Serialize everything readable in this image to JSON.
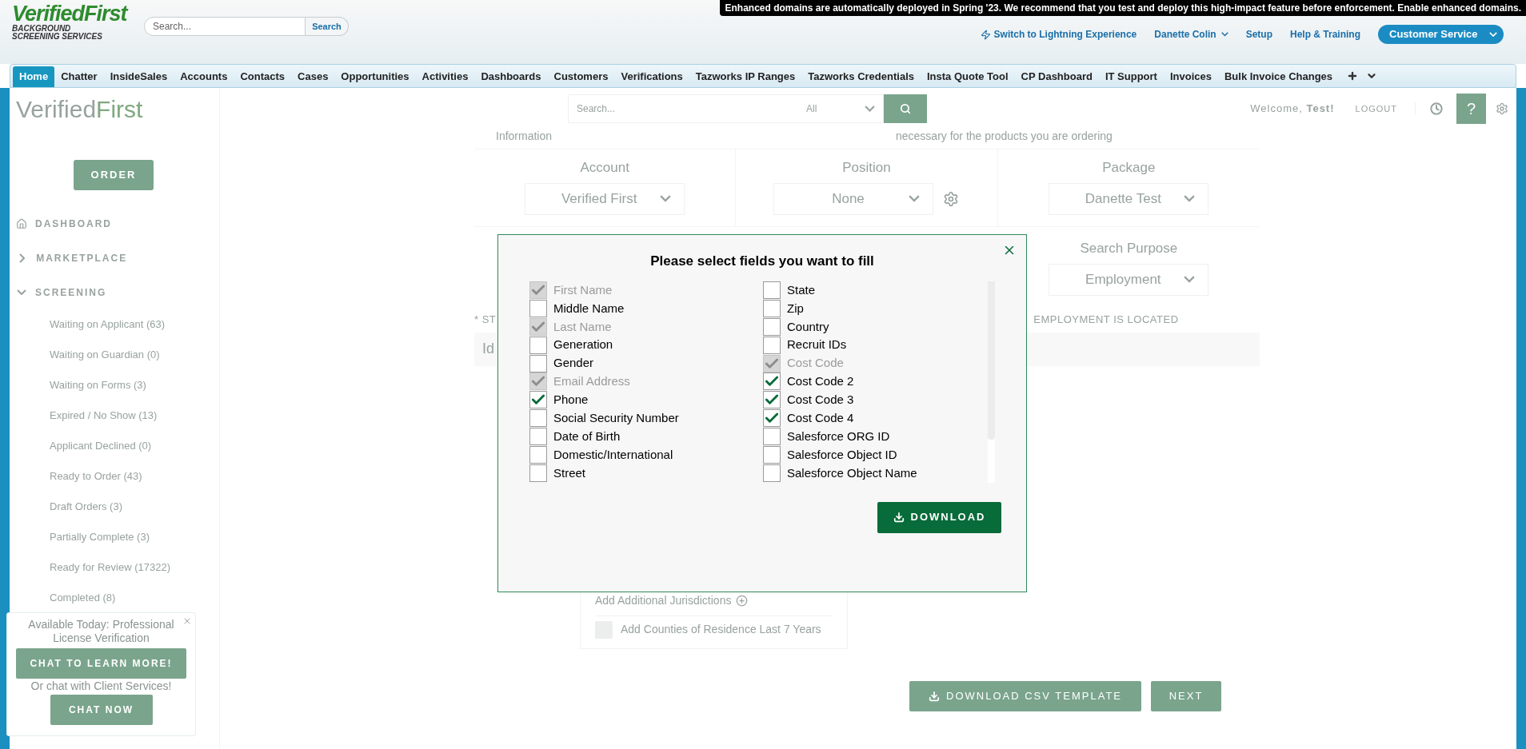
{
  "header": {
    "logo_title": "VerifiedFirst",
    "logo_lines": [
      "BACKGROUND",
      "SCREENING SERVICES"
    ],
    "search_placeholder": "Search...",
    "search_button": "Search",
    "notice": "Enhanced domains are automatically deployed in Spring '23. We recommend that you test and deploy this high-impact feature before enforcement. Enable enhanced domains.",
    "lightning_link": "Switch to Lightning Experience",
    "user_menu": "Danette Colin",
    "links": [
      "Setup",
      "Help & Training"
    ],
    "app_menu": "Customer Service"
  },
  "tabs": [
    {
      "label": "Home",
      "selected": true
    },
    {
      "label": "Chatter",
      "selected": false
    },
    {
      "label": "InsideSales",
      "selected": false
    },
    {
      "label": "Accounts",
      "selected": false
    },
    {
      "label": "Contacts",
      "selected": false
    },
    {
      "label": "Cases",
      "selected": false
    },
    {
      "label": "Opportunities",
      "selected": false
    },
    {
      "label": "Activities",
      "selected": false
    },
    {
      "label": "Dashboards",
      "selected": false
    },
    {
      "label": "Customers",
      "selected": false
    },
    {
      "label": "Verifications",
      "selected": false
    },
    {
      "label": "Tazworks IP Ranges",
      "selected": false
    },
    {
      "label": "Tazworks Credentials",
      "selected": false
    },
    {
      "label": "Insta Quote Tool",
      "selected": false
    },
    {
      "label": "CP Dashboard",
      "selected": false
    },
    {
      "label": "IT Support",
      "selected": false
    },
    {
      "label": "Invoices",
      "selected": false
    },
    {
      "label": "Bulk Invoice Changes",
      "selected": false
    }
  ],
  "app_header": {
    "logo": [
      "Verified",
      "First"
    ],
    "search_placeholder": "Search...",
    "search_filter": "All",
    "welcome": "Welcome, **Test!**",
    "logout": "LOGOUT",
    "help": "?"
  },
  "sidebar": {
    "order_button": "ORDER",
    "nav": [
      {
        "label": "DASHBOARD",
        "kind": "home"
      },
      {
        "label": "MARKETPLACE",
        "kind": "group",
        "expanded": false
      },
      {
        "label": "SCREENING",
        "kind": "group",
        "expanded": true,
        "children": [
          "Waiting on Applicant (63)",
          "Waiting on Guardian (0)",
          "Waiting on Forms (3)",
          "Expired / No Show (13)",
          "Applicant Declined (0)",
          "Ready to Order (43)",
          "Draft Orders (3)",
          "Partially Complete (3)",
          "Ready for Review (17322)",
          "Completed (8)"
        ]
      }
    ]
  },
  "chat_popup": {
    "headline": "Available Today: Professional License Verification",
    "primary_button": "CHAT TO LEARN MORE!",
    "subline": "Or chat with Client Services!",
    "secondary_button": "CHAT NOW"
  },
  "form": {
    "intro_left": "Information",
    "intro_right": "necessary for the products you are ordering",
    "selects": [
      {
        "label": "Account",
        "value": "Verified First",
        "settings": false
      },
      {
        "label": "Position",
        "value": "None",
        "settings": true
      },
      {
        "label": "Package",
        "value": "Danette Test",
        "settings": false
      }
    ],
    "purpose": {
      "label": "Search Purpose",
      "value": "Employment"
    },
    "state_label": "* ST",
    "location_label": "EMPLOYMENT IS LOCATED",
    "state_value": "Id",
    "jurisdictions_link": "Add Additional Jurisdictions",
    "counties": {
      "label": "Add Counties of Residence Last 7 Years",
      "checked": false
    },
    "buttons": [
      "DOWNLOAD CSV TEMPLATE",
      "NEXT"
    ]
  },
  "modal": {
    "title": "Please select fields you want to fill",
    "download_button": "DOWNLOAD",
    "columns": [
      [
        {
          "label": "First Name",
          "checked": true,
          "disabled": true
        },
        {
          "label": "Middle Name",
          "checked": false,
          "disabled": false
        },
        {
          "label": "Last Name",
          "checked": true,
          "disabled": true
        },
        {
          "label": "Generation",
          "checked": false,
          "disabled": false
        },
        {
          "label": "Gender",
          "checked": false,
          "disabled": false
        },
        {
          "label": "Email Address",
          "checked": true,
          "disabled": true
        },
        {
          "label": "Phone",
          "checked": true,
          "disabled": false
        },
        {
          "label": "Social Security Number",
          "checked": false,
          "disabled": false
        },
        {
          "label": "Date of Birth",
          "checked": false,
          "disabled": false
        },
        {
          "label": "Domestic/International",
          "checked": false,
          "disabled": false
        },
        {
          "label": "Street",
          "checked": false,
          "disabled": false
        }
      ],
      [
        {
          "label": "State",
          "checked": false,
          "disabled": false
        },
        {
          "label": "Zip",
          "checked": false,
          "disabled": false
        },
        {
          "label": "Country",
          "checked": false,
          "disabled": false
        },
        {
          "label": "Recruit IDs",
          "checked": false,
          "disabled": false
        },
        {
          "label": "Cost Code",
          "checked": true,
          "disabled": true
        },
        {
          "label": "Cost Code 2",
          "checked": true,
          "disabled": false
        },
        {
          "label": "Cost Code 3",
          "checked": true,
          "disabled": false
        },
        {
          "label": "Cost Code 4",
          "checked": true,
          "disabled": false
        },
        {
          "label": "Salesforce ORG ID",
          "checked": false,
          "disabled": false
        },
        {
          "label": "Salesforce Object ID",
          "checked": false,
          "disabled": false
        },
        {
          "label": "Salesforce Object Name",
          "checked": false,
          "disabled": false
        }
      ]
    ]
  }
}
